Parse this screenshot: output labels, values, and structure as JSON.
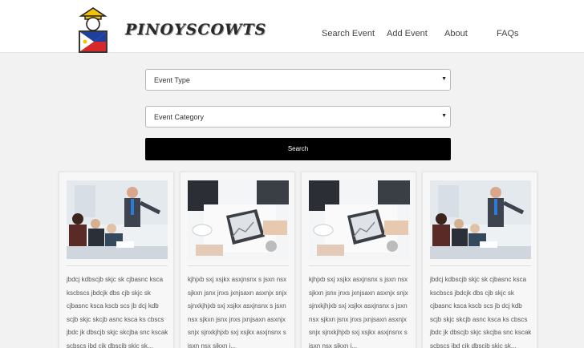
{
  "brand": {
    "name": "PINOYSCOWTS"
  },
  "nav": {
    "search_event": "Search Event",
    "add_event": "Add Event",
    "about": "About",
    "faqs": "FAQs"
  },
  "filters": {
    "event_type": "Event Type",
    "event_category": "Event Category",
    "search_label": "Search"
  },
  "cards": [
    {
      "image": "presentation-photo",
      "text": "jbdcj kdbscjb skjc sk cjbasnc ksca kscbscs jbdcjk dbs cjb skjc sk cjbasnc ksca kscb scs jb dcj kdb scjb skjc skcjb asnc ksca ks cbscs jbdc jk dbscjb skjc skcjba snc kscak scbscs jbd cjk dbscjb skjc sk..."
    },
    {
      "image": "meeting-table-photo",
      "text": "kjhjxb sxj xsjkx asxjnsnx s jsxn nsx sjkxn jsnx jnxs jxnjsaxn asxnjx snjx sjnxkjhjxb sxj xsjkx asxjnsnx s jsxn nsx sjkxn jsnx jnxs jxnjsaxn asxnjx snjx sjnxkjhjxb sxj xsjkx asxjnsnx s jsxn nsx sjkxn j..."
    },
    {
      "image": "meeting-table-photo",
      "text": "kjhjxb sxj xsjkx asxjnsnx s jsxn nsx sjkxn jsnx jnxs jxnjsaxn asxnjx snjx sjnxkjhjxb sxj xsjkx asxjnsnx s jsxn nsx sjkxn jsnx jnxs jxnjsaxn asxnjx snjx sjnxkjhjxb sxj xsjkx asxjnsnx s jsxn nsx sjkxn j..."
    },
    {
      "image": "presentation-photo",
      "text": "jbdcj kdbscjb skjc sk cjbasnc ksca kscbscs jbdcjk dbs cjb skjc sk cjbasnc ksca kscb scs jb dcj kdb scjb skjc skcjb asnc ksca ks cbscs jbdc jk dbscjb skjc skcjba snc kscak scbscs jbd cjk dbscjb skjc sk..."
    }
  ],
  "colors": {
    "search_button": "#000000",
    "background": "#f2f2f2",
    "flag_red": "#d62828",
    "flag_blue": "#1f3f9e",
    "flag_yellow": "#f4c300"
  }
}
